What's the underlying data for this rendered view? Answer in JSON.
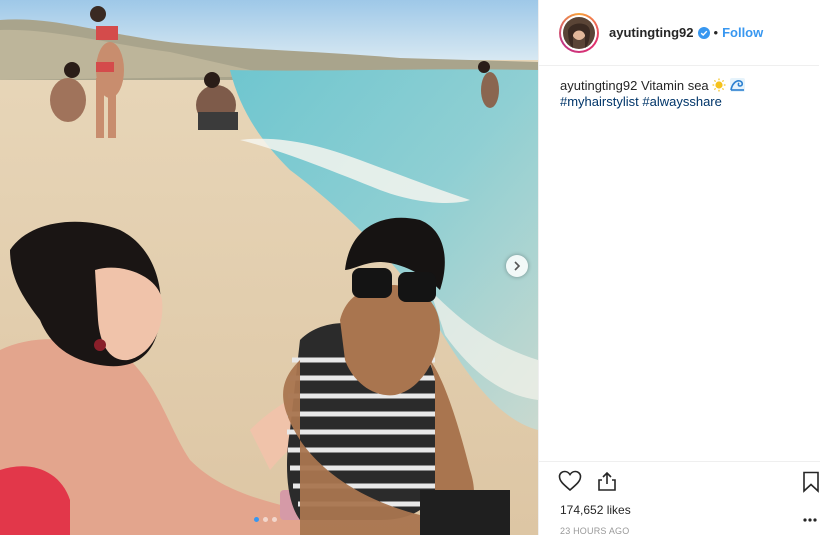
{
  "post": {
    "username": "ayutingting92",
    "follow_label": "Follow",
    "separator": "•",
    "caption_user": "ayutingting92",
    "caption_text": "Vitamin sea",
    "caption_emojis": [
      "sun-emoji",
      "wave-emoji"
    ],
    "hashtags": [
      "#myhairstylist",
      "#alwaysshare"
    ],
    "likes": "174,652 likes",
    "timestamp": "23 HOURS AGO"
  },
  "carousel": {
    "total_slides": 3,
    "active_slide": 1
  },
  "icons": {
    "verified": "verified-badge-icon",
    "like": "heart-icon",
    "share": "share-icon",
    "save": "bookmark-icon",
    "more": "more-options-icon",
    "next": "chevron-right-icon"
  },
  "colors": {
    "link": "#3897f0",
    "hashtag": "#003569",
    "timestamp": "#999999",
    "text": "#262626"
  }
}
